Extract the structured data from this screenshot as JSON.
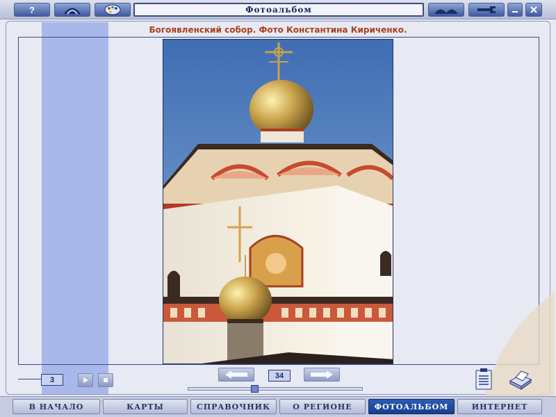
{
  "window": {
    "title": "Фотоальбом",
    "help_label": "?"
  },
  "caption": "Богоявленский собор. Фото Константина Кириченко.",
  "photo": {
    "description_icon": "cathedral-photo"
  },
  "controls": {
    "current_index": "3",
    "page_number": "34"
  },
  "nav": {
    "items": [
      {
        "label": "В НАЧАЛО"
      },
      {
        "label": "КАРТЫ"
      },
      {
        "label": "СПРАВОЧНИК"
      },
      {
        "label": "О РЕГИОНЕ"
      },
      {
        "label": "ФОТОАЛЬБОМ"
      },
      {
        "label": "ИНТЕРНЕТ"
      }
    ],
    "active_index": 4
  },
  "colors": {
    "accent": "#1f4aa0",
    "caption": "#a8401e",
    "strip": "#a9b8ea"
  }
}
